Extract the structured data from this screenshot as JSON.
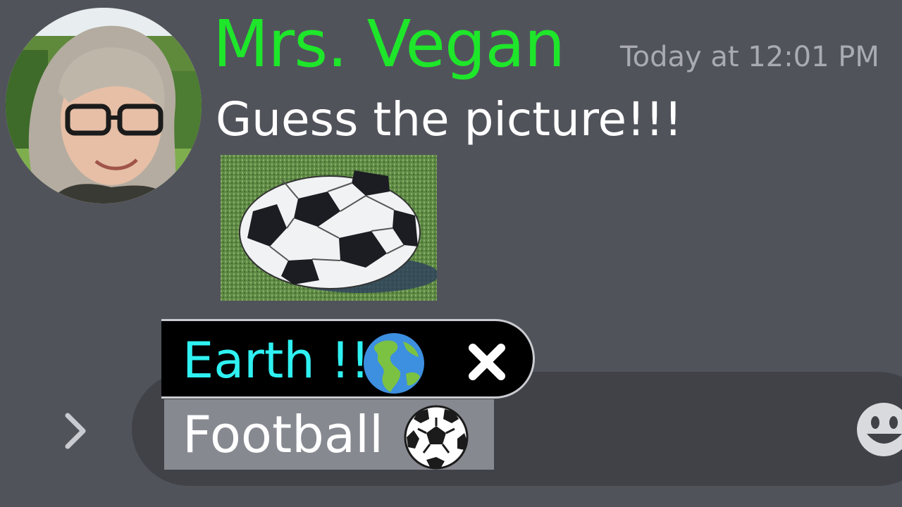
{
  "message": {
    "author": "Mrs. Vegan",
    "timestamp": "Today at 12:01 PM",
    "text": "Guess the picture!!!",
    "author_color": "#1ee62a"
  },
  "icons": {
    "avatar": "avatar-photo",
    "attachment": "soccer-ball-photo",
    "expand": "chevron-right-icon",
    "emoji": "smiley-face-icon",
    "globe": "globe-americas-icon",
    "wrong": "x-mark-icon",
    "ball": "soccer-ball-emoji-icon"
  },
  "choices": {
    "wrong": {
      "label": "Earth !!",
      "color": "#2ff1f1"
    },
    "right": {
      "label": "Football"
    }
  }
}
